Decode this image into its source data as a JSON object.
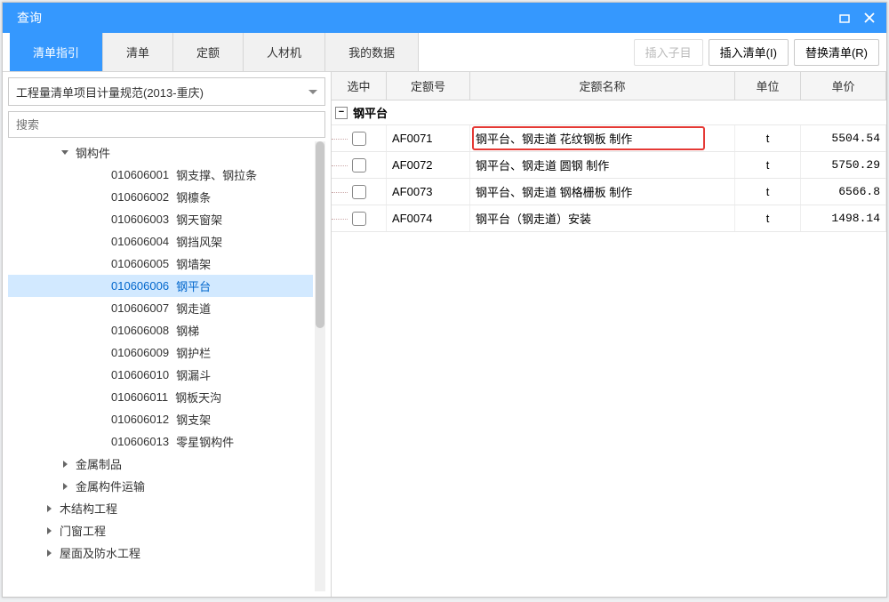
{
  "titlebar": {
    "title": "查询"
  },
  "tabs": [
    {
      "label": "清单指引",
      "active": true
    },
    {
      "label": "清单"
    },
    {
      "label": "定额"
    },
    {
      "label": "人材机"
    },
    {
      "label": "我的数据"
    }
  ],
  "toolbar_buttons": {
    "insert_sub": "插入子目",
    "insert_list": "插入清单(I)",
    "replace_list": "替换清单(R)"
  },
  "dropdown": {
    "label": "工程量清单项目计量规范(2013-重庆)"
  },
  "search": {
    "placeholder": "搜索"
  },
  "tree": [
    {
      "level": 2,
      "arrow": "expanded",
      "label": "钢构件"
    },
    {
      "level": 4,
      "arrow": "none",
      "code": "010606001",
      "label": "钢支撑、钢拉条"
    },
    {
      "level": 4,
      "arrow": "none",
      "code": "010606002",
      "label": "钢檩条"
    },
    {
      "level": 4,
      "arrow": "none",
      "code": "010606003",
      "label": "钢天窗架"
    },
    {
      "level": 4,
      "arrow": "none",
      "code": "010606004",
      "label": "钢挡风架"
    },
    {
      "level": 4,
      "arrow": "none",
      "code": "010606005",
      "label": "钢墙架"
    },
    {
      "level": 4,
      "arrow": "none",
      "code": "010606006",
      "label": "钢平台",
      "selected": true
    },
    {
      "level": 4,
      "arrow": "none",
      "code": "010606007",
      "label": "钢走道"
    },
    {
      "level": 4,
      "arrow": "none",
      "code": "010606008",
      "label": "钢梯"
    },
    {
      "level": 4,
      "arrow": "none",
      "code": "010606009",
      "label": "钢护栏"
    },
    {
      "level": 4,
      "arrow": "none",
      "code": "010606010",
      "label": "钢漏斗"
    },
    {
      "level": 4,
      "arrow": "none",
      "code": "010606011",
      "label": "钢板天沟"
    },
    {
      "level": 4,
      "arrow": "none",
      "code": "010606012",
      "label": "钢支架"
    },
    {
      "level": 4,
      "arrow": "none",
      "code": "010606013",
      "label": "零星钢构件"
    },
    {
      "level": 2,
      "arrow": "collapsed",
      "label": "金属制品"
    },
    {
      "level": 2,
      "arrow": "collapsed",
      "label": "金属构件运输"
    },
    {
      "level": 1,
      "arrow": "collapsed",
      "label": "木结构工程"
    },
    {
      "level": 1,
      "arrow": "collapsed",
      "label": "门窗工程"
    },
    {
      "level": 1,
      "arrow": "collapsed",
      "label": "屋面及防水工程"
    }
  ],
  "grid": {
    "headers": {
      "sel": "选中",
      "code": "定额号",
      "name": "定额名称",
      "unit": "单位",
      "price": "单价"
    },
    "group": "钢平台",
    "rows": [
      {
        "code": "AF0071",
        "name": "钢平台、钢走道 花纹钢板 制作",
        "unit": "t",
        "price": "5504.54",
        "highlight": true
      },
      {
        "code": "AF0072",
        "name": "钢平台、钢走道 圆钢 制作",
        "unit": "t",
        "price": "5750.29"
      },
      {
        "code": "AF0073",
        "name": "钢平台、钢走道 钢格栅板 制作",
        "unit": "t",
        "price": "6566.8"
      },
      {
        "code": "AF0074",
        "name": "钢平台（钢走道）安装",
        "unit": "t",
        "price": "1498.14"
      }
    ]
  }
}
